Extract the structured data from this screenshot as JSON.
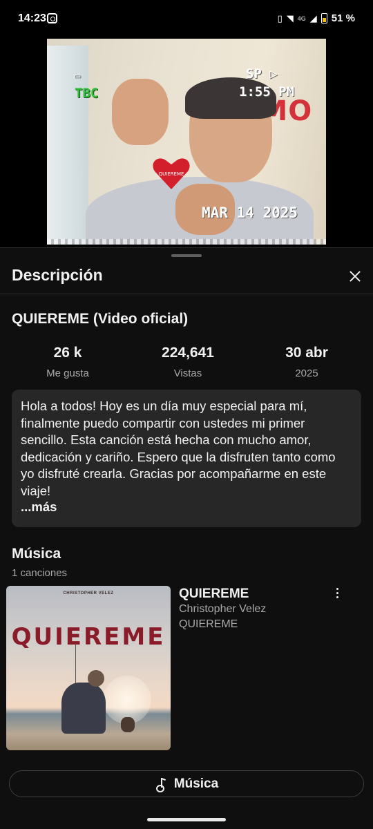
{
  "status_bar": {
    "time": "14:23",
    "battery": "51 %",
    "network": "4G",
    "icons": [
      "instagram-icon",
      "vibrate-icon",
      "wifi-icon",
      "signal-icon",
      "battery-icon"
    ]
  },
  "video": {
    "overlay_mode": "SP",
    "overlay_time": "1:55 PM",
    "overlay_tbc": "TBC",
    "overlay_date": "MAR 14 2025",
    "backdrop_text": "TE AMO",
    "keychain_text": "QUIEREME"
  },
  "sheet": {
    "title": "Descripción",
    "close_icon": "close-icon"
  },
  "video_info": {
    "title": "QUIEREME (Video oficial)",
    "stats": [
      {
        "value": "26 k",
        "label": "Me gusta"
      },
      {
        "value": "224,641",
        "label": "Vistas"
      },
      {
        "value": "30 abr",
        "label": "2025"
      }
    ],
    "description": "Hola a todos! Hoy es un día muy especial para mí, finalmente puedo compartir con ustedes mi primer sencillo. Esta canción está hecha con mucho amor, dedicación y cariño. Espero que la disfruten tanto como yo disfruté crearla. Gracias por acompañarme en este viaje!",
    "more_label": "...más"
  },
  "music": {
    "heading": "Música",
    "count": "1 canciones",
    "track": {
      "title": "QUIEREME",
      "artist": "Christopher Velez",
      "album": "QUIEREME",
      "cover_artist": "CHRISTOPHER VELEZ",
      "cover_title": "QUIEREME"
    },
    "button_label": "Música"
  },
  "colors": {
    "background": "#0f0f0f",
    "card": "#272727",
    "text_primary": "#f1f1f1",
    "text_secondary": "#aaaaaa"
  }
}
